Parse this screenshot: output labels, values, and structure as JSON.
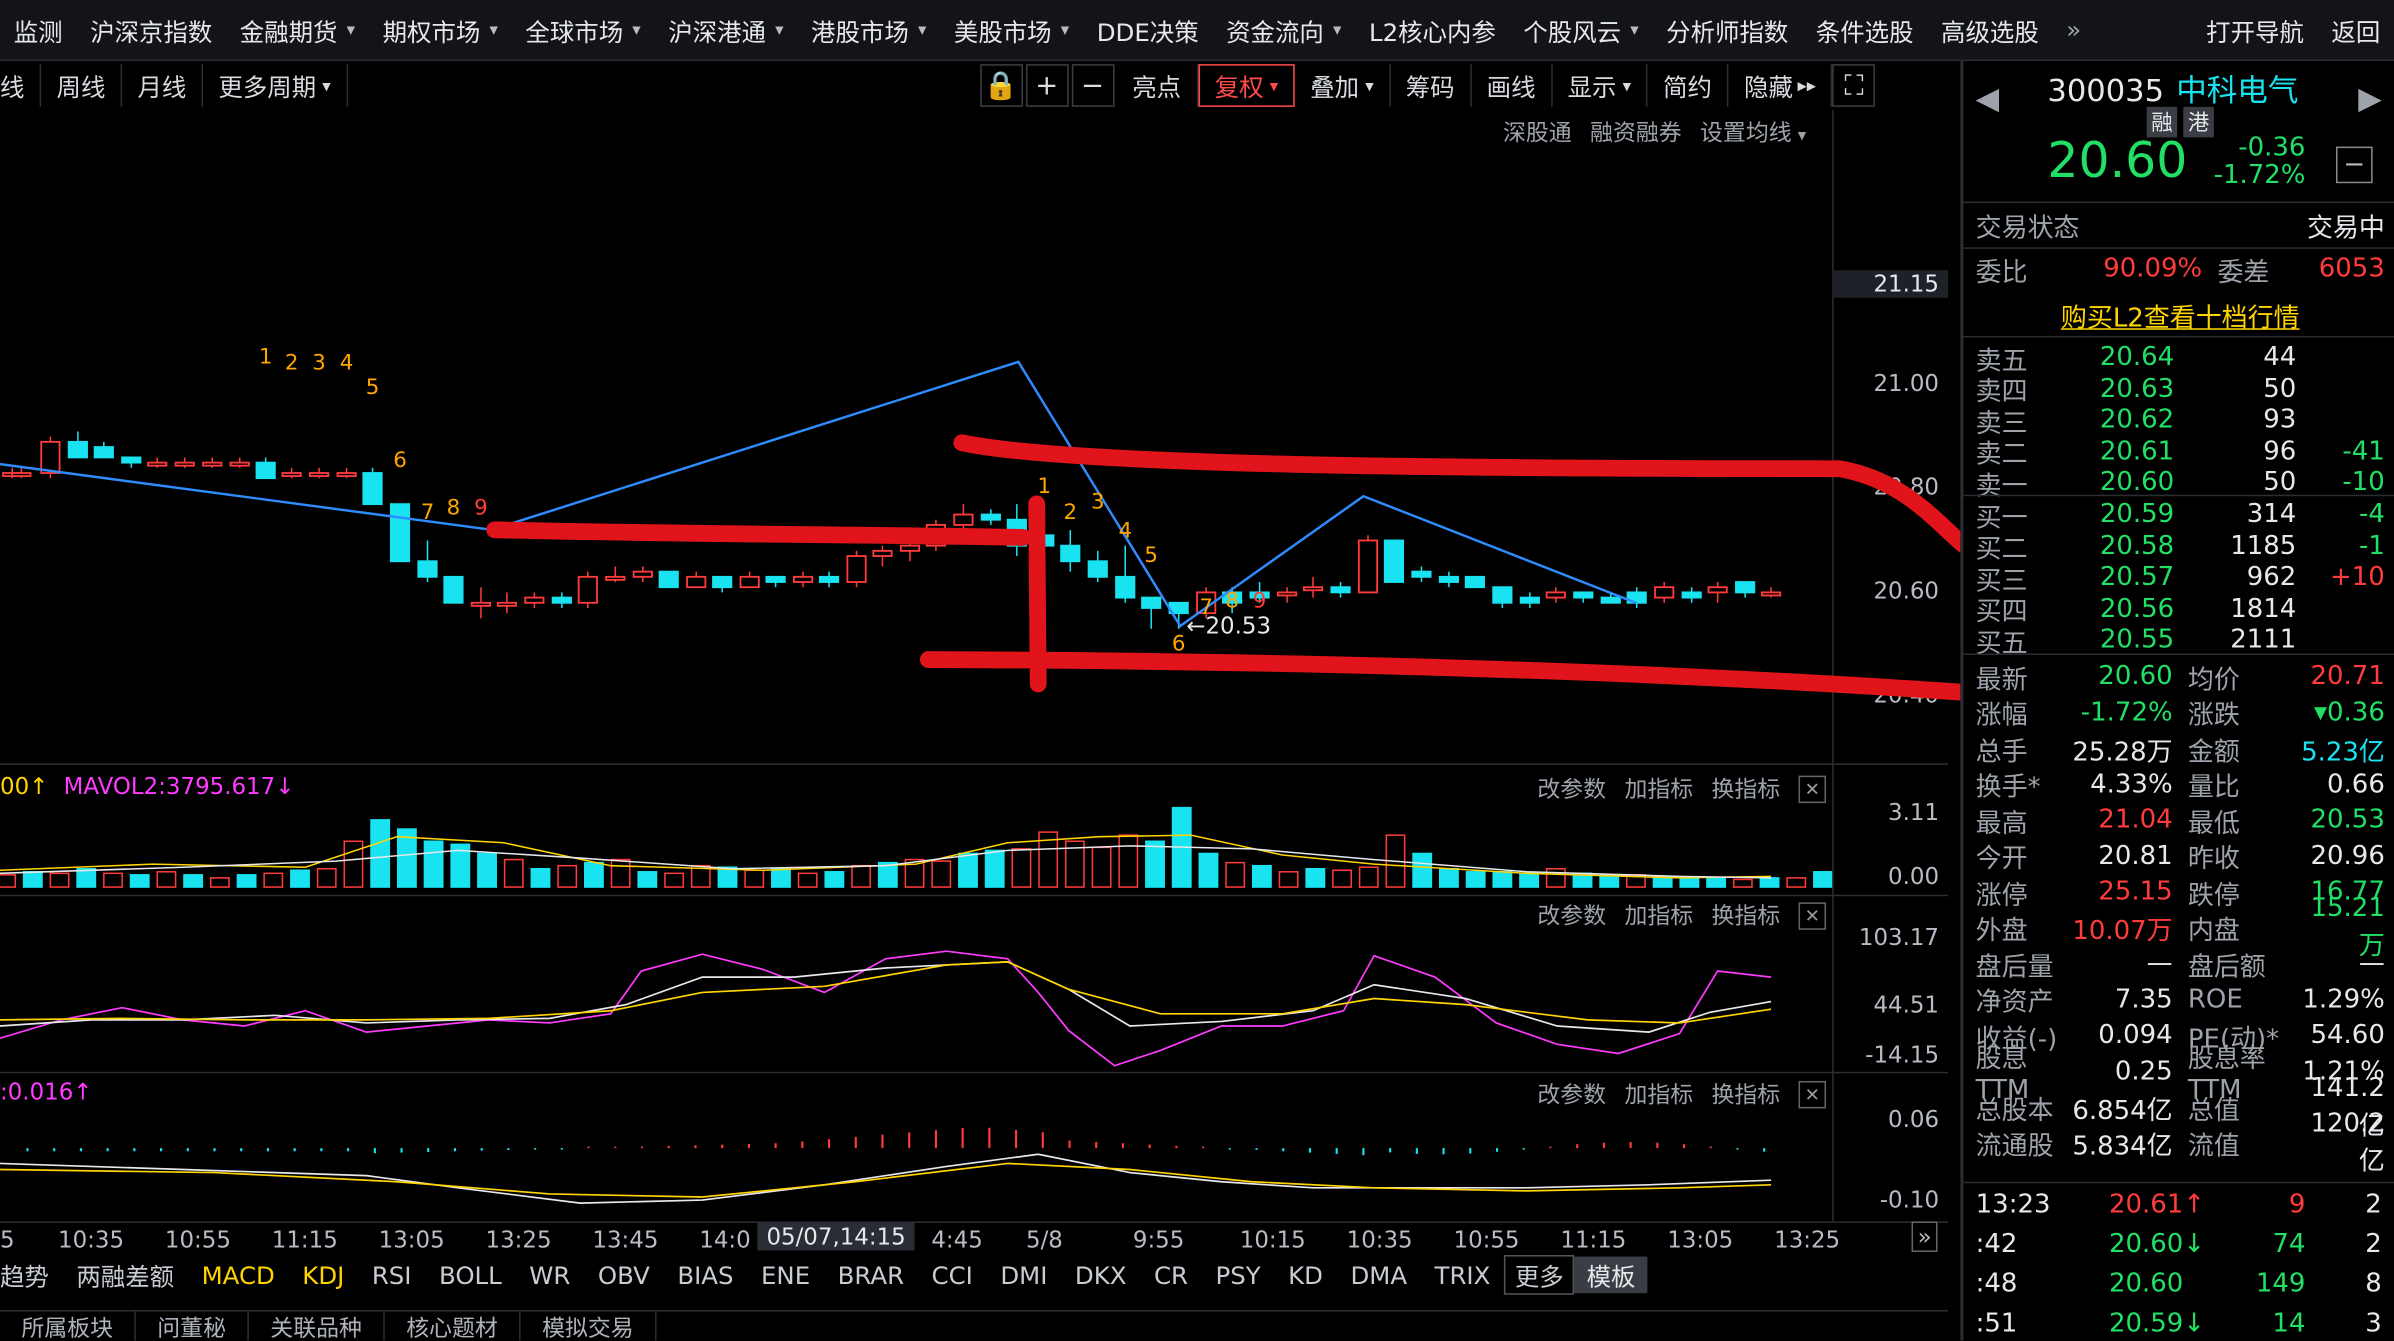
{
  "topnav": {
    "items": [
      "监测",
      "沪深京指数",
      "金融期货",
      "期权市场",
      "全球市场",
      "沪深港通",
      "港股市场",
      "美股市场",
      "DDE决策",
      "资金流向",
      "L2核心内参",
      "个股风云",
      "分析师指数",
      "条件选股",
      "高级选股"
    ],
    "more": "»",
    "nav": "打开导航",
    "back": "返回"
  },
  "toolbar": {
    "periods": [
      "线",
      "周线",
      "月线",
      "更多周期"
    ],
    "lock": "🔒",
    "plus": "+",
    "minus": "−",
    "tools": [
      "亮点",
      "复权",
      "叠加",
      "筹码",
      "画线",
      "显示",
      "简约",
      "隐藏"
    ],
    "expand": "⛶"
  },
  "subbar": [
    "深股通",
    "融资融券",
    "设置均线"
  ],
  "price_axis": [
    "21.15",
    "21.00",
    "20.80",
    "20.60",
    "20.40"
  ],
  "candles": {
    "labels_top": [
      "1",
      "2",
      "3",
      "4",
      "5",
      "6",
      "7",
      "8",
      "9"
    ],
    "labels_mid": [
      "1",
      "2",
      "3",
      "4",
      "5",
      "6",
      "7",
      "8",
      "9"
    ],
    "low_label": "←20.53"
  },
  "vol": {
    "head1": "00",
    "head2": "MAVOL2:3795.617",
    "axis": [
      "3.11",
      "0.00"
    ]
  },
  "kdj": {
    "axis": [
      "103.17",
      "44.51",
      "-14.15"
    ]
  },
  "macd": {
    "head": ":0.016",
    "axis": [
      "0.06",
      "-0.10"
    ]
  },
  "ind_tools": [
    "改参数",
    "加指标",
    "换指标"
  ],
  "close_icon": "✕",
  "xaxis": {
    "ticks": [
      "5",
      "10:35",
      "10:55",
      "11:15",
      "13:05",
      "13:25",
      "13:45",
      "14:0",
      "4:45",
      "5/8",
      "9:55",
      "10:15",
      "10:35",
      "10:55",
      "11:15",
      "13:05",
      "13:25"
    ],
    "cursor": "05/07,14:15"
  },
  "itabs": [
    "趋势",
    "两融差额",
    "MACD",
    "KDJ",
    "RSI",
    "BOLL",
    "WR",
    "OBV",
    "BIAS",
    "ENE",
    "BRAR",
    "CCI",
    "DMI",
    "DKX",
    "CR",
    "PSY",
    "KD",
    "DMA",
    "TRIX",
    "更多",
    "模板"
  ],
  "btabs": [
    "所属板块",
    "问董秘",
    "关联品种",
    "核心题材",
    "模拟交易"
  ],
  "quote": {
    "code": "300035",
    "name": "中科电气",
    "tag1": "融",
    "tag2": "港",
    "price": "20.60",
    "chg": "-0.36",
    "pct": "-1.72%",
    "status_label": "交易状态",
    "status": "交易中",
    "wb_label": "委比",
    "wb": "90.09%",
    "wc_label": "委差",
    "wc": "6053",
    "l2": "购买L2查看十档行情"
  },
  "sells": [
    {
      "l": "卖五",
      "p": "20.64",
      "v": "44",
      "d": ""
    },
    {
      "l": "卖四",
      "p": "20.63",
      "v": "50",
      "d": ""
    },
    {
      "l": "卖三",
      "p": "20.62",
      "v": "93",
      "d": ""
    },
    {
      "l": "卖二",
      "p": "20.61",
      "v": "96",
      "d": "-41"
    },
    {
      "l": "卖一",
      "p": "20.60",
      "v": "50",
      "d": "-10"
    }
  ],
  "buys": [
    {
      "l": "买一",
      "p": "20.59",
      "v": "314",
      "d": "-4"
    },
    {
      "l": "买二",
      "p": "20.58",
      "v": "1185",
      "d": "-1"
    },
    {
      "l": "买三",
      "p": "20.57",
      "v": "962",
      "d": "+10"
    },
    {
      "l": "买四",
      "p": "20.56",
      "v": "1814",
      "d": ""
    },
    {
      "l": "买五",
      "p": "20.55",
      "v": "2111",
      "d": ""
    }
  ],
  "stats": [
    [
      "最新",
      "20.60",
      "均价",
      "20.71"
    ],
    [
      "涨幅",
      "-1.72%",
      "涨跌",
      "▾0.36"
    ],
    [
      "总手",
      "25.28万",
      "金额",
      "5.23亿"
    ],
    [
      "换手*",
      "4.33%",
      "量比",
      "0.66"
    ],
    [
      "最高",
      "21.04",
      "最低",
      "20.53"
    ],
    [
      "今开",
      "20.81",
      "昨收",
      "20.96"
    ],
    [
      "涨停",
      "25.15",
      "跌停",
      "16.77"
    ],
    [
      "外盘",
      "10.07万",
      "内盘",
      "15.21万"
    ],
    [
      "盘后量",
      "—",
      "盘后额",
      "—"
    ],
    [
      "净资产",
      "7.35",
      "ROE",
      "1.29%"
    ],
    [
      "收益(-)",
      "0.094",
      "PE(动)*",
      "54.60"
    ],
    [
      "股息TTM",
      "0.25",
      "股息率TTM",
      "1.21%"
    ],
    [
      "总股本",
      "6.854亿",
      "总值",
      "141.2亿"
    ],
    [
      "流通股",
      "5.834亿",
      "流值",
      "120.2亿"
    ]
  ],
  "ticks": [
    {
      "t": "13:23",
      "p": "20.61",
      "a": "↑",
      "v": "9",
      "n": "2"
    },
    {
      "t": ":42",
      "p": "20.60",
      "a": "↓",
      "v": "74",
      "n": "2"
    },
    {
      "t": ":48",
      "p": "20.60",
      "a": "",
      "v": "149",
      "n": "8"
    },
    {
      "t": ":51",
      "p": "20.59",
      "a": "↓",
      "v": "14",
      "n": "3"
    }
  ],
  "colors": {
    "up": "#ff3b3b",
    "down": "#19e3f0",
    "annot": "#e0141a",
    "trend": "#2f8cff"
  }
}
